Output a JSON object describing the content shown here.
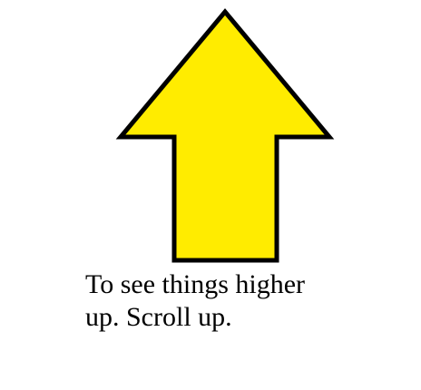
{
  "caption": {
    "line1": "To see things higher",
    "line2": "up. Scroll up."
  },
  "arrow": {
    "icon": "up-arrow-icon",
    "fill_color": "#ffec00",
    "stroke_color": "#000000"
  }
}
